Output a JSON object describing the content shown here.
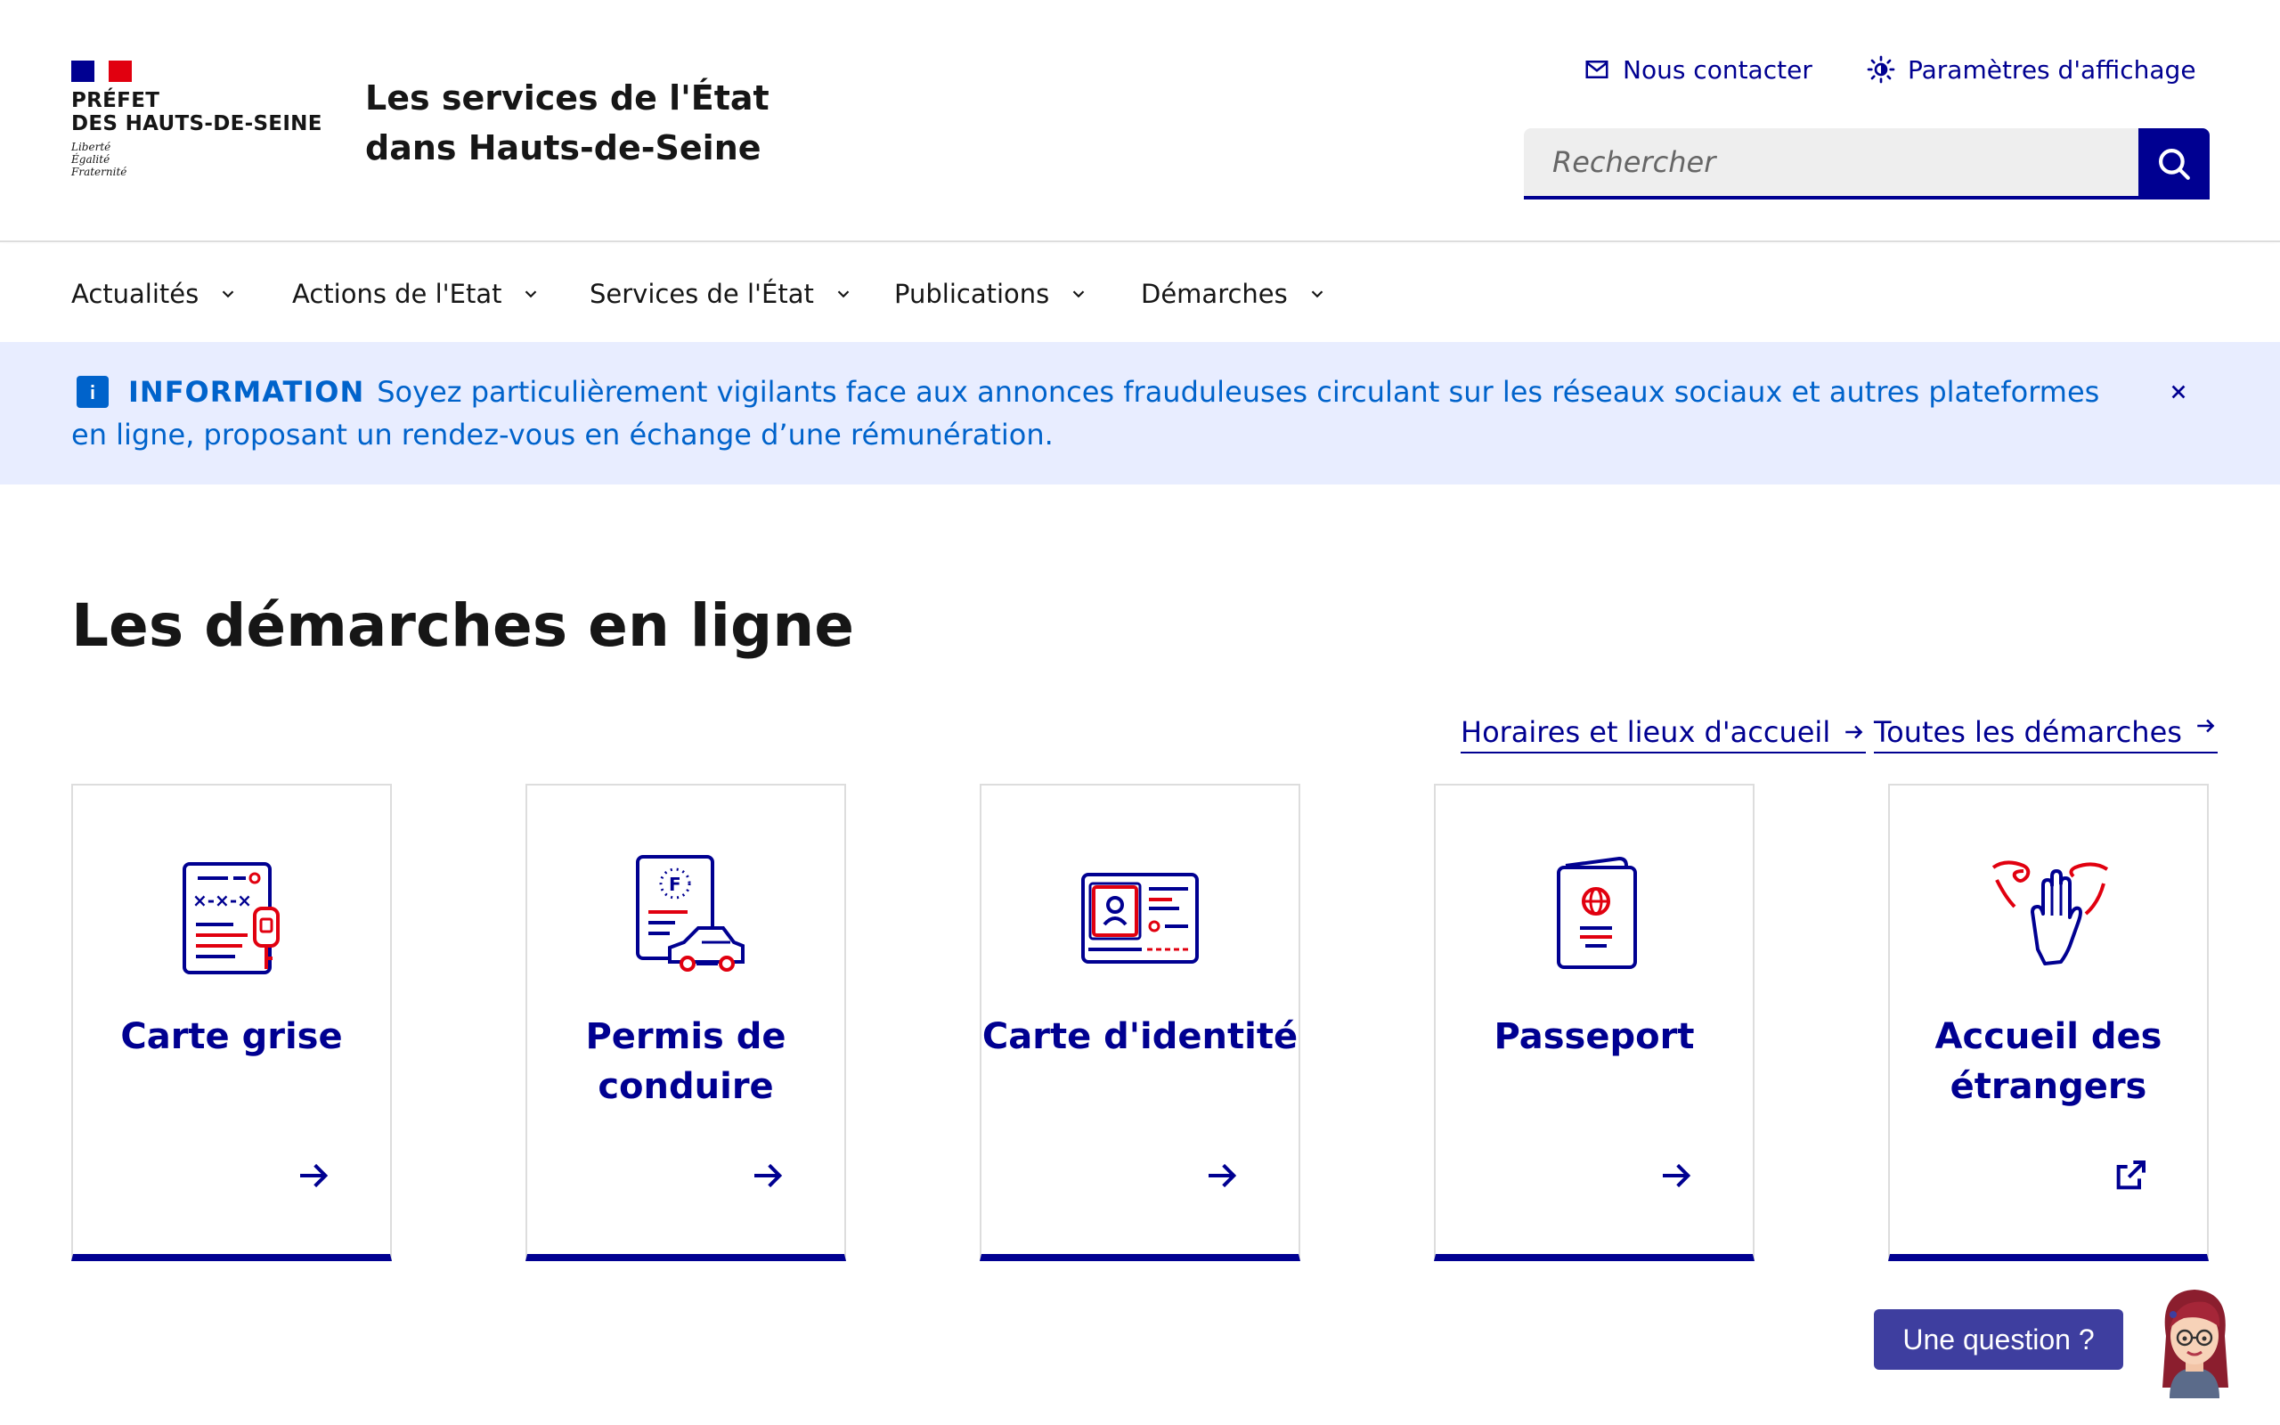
{
  "header": {
    "logo": {
      "line1": "PRÉFET",
      "line2": "DES HAUTS-DE-SEINE",
      "motto1": "Liberté",
      "motto2": "Égalité",
      "motto3": "Fraternité"
    },
    "site_title": "Les services de l'État dans Hauts-de-Seine",
    "tools": {
      "contact": "Nous contacter",
      "display": "Paramètres d'affichage"
    },
    "search": {
      "placeholder": "Rechercher"
    }
  },
  "nav": {
    "items": [
      {
        "label": "Actualités"
      },
      {
        "label": "Actions de l'Etat"
      },
      {
        "label": "Services de l'État"
      },
      {
        "label": "Publications"
      },
      {
        "label": "Démarches"
      }
    ]
  },
  "notice": {
    "label": "INFORMATION",
    "text": "Soyez particulièrement vigilants face aux annonces frauduleuses circulant sur les réseaux sociaux et autres plateformes en ligne, proposant un rendez-vous en échange d’une rémunération."
  },
  "main": {
    "section_title": "Les démarches en ligne",
    "links": {
      "hours": "Horaires et lieux d'accueil",
      "all": "Toutes les démarches"
    },
    "cards": [
      {
        "title": "Carte grise",
        "icon": "vehicle-registration-icon"
      },
      {
        "title": "Permis de conduire",
        "icon": "driving-license-icon"
      },
      {
        "title": "Carte d'identité",
        "icon": "id-card-icon"
      },
      {
        "title": "Passeport",
        "icon": "passport-icon"
      },
      {
        "title": "Accueil des étrangers",
        "icon": "welcome-hands-icon"
      }
    ]
  },
  "chat": {
    "label": "Une question ?"
  },
  "colors": {
    "primary": "#000091",
    "accent_red": "#e1000f",
    "info_bg": "#e8edff",
    "info_text": "#0063cb"
  }
}
